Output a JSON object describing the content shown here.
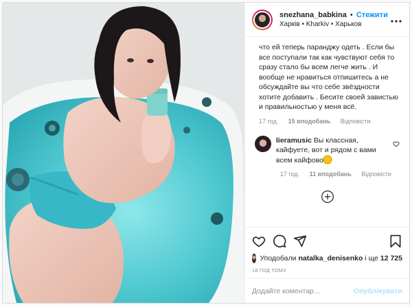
{
  "header": {
    "username": "snezhana_babkina",
    "separator": "•",
    "follow_label": "Стежити",
    "location": "Харків • Kharkiv • Харьков",
    "more_icon": "more-icon"
  },
  "caption": {
    "text": "что ей теперь паранджу одеть . Если бы все поступали так как чувствуют себя то сразу стало бы всем легче жить . И вообще не нравиться отпишитесь а не обсуждайте вы что себе звёздности хотите добавить . Бесите своей завистью и правильностью у меня всё.",
    "time": "17 год.",
    "likes": "15 вподобань",
    "reply": "Відповісти"
  },
  "comment": {
    "username": "lieramusic",
    "text": "Вы классная, кайфуете, вот и рядом с вами всем кайфово",
    "time": "17 год.",
    "likes": "11 вподобань",
    "reply": "Відповісти"
  },
  "likes_line": {
    "prefix": "Уподобали",
    "user": "natalka_denisenko",
    "middle": "і ще",
    "count": "12 725"
  },
  "timestamp": "18 ГОД ТОМУ",
  "add_comment": {
    "placeholder": "Додайте коментар...",
    "publish_label": "Опублікувати"
  },
  "colors": {
    "accent": "#0095f6",
    "publish_disabled": "#b2dffc",
    "muted": "#8e8e8e",
    "water": "#5fd0d6"
  }
}
